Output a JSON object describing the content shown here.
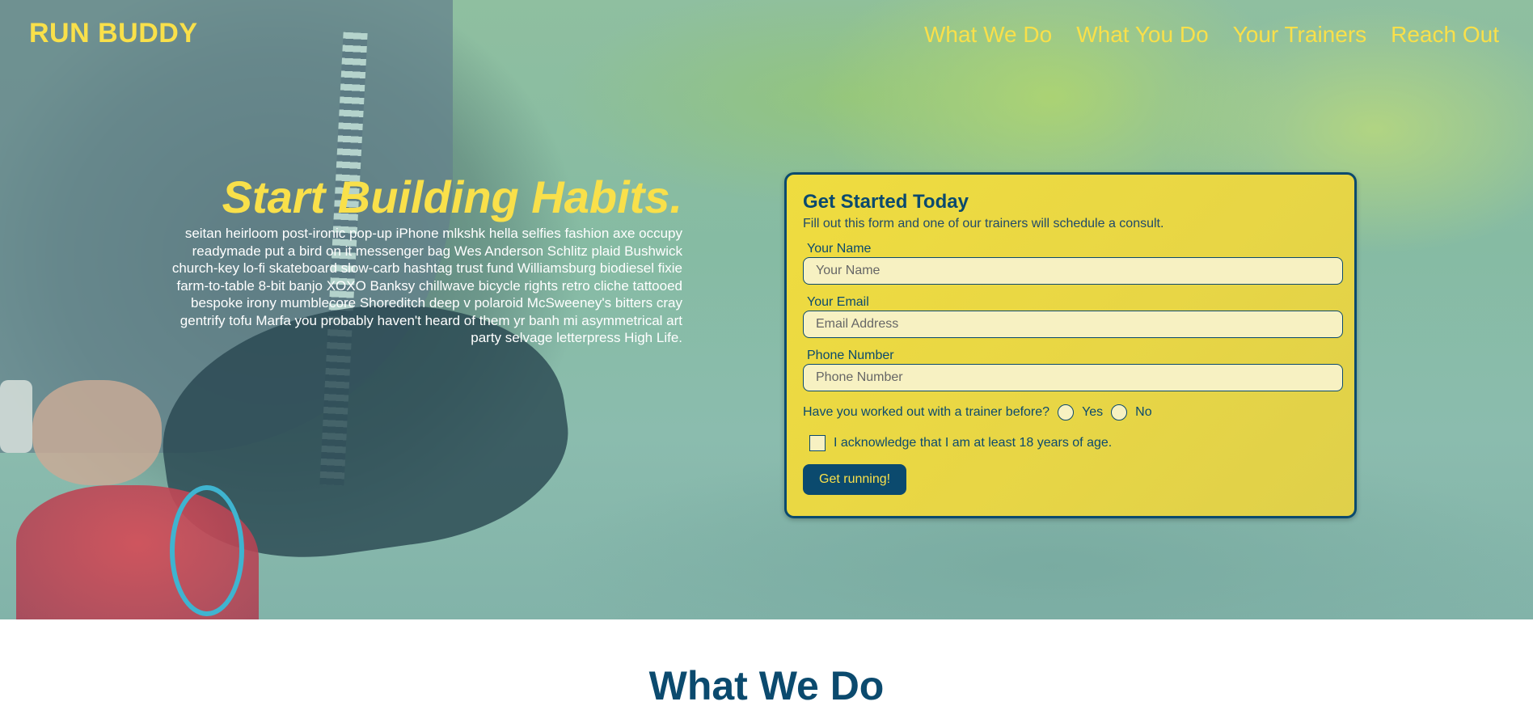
{
  "header": {
    "logo": "RUN BUDDY",
    "nav": [
      "What We Do",
      "What You Do",
      "Your Trainers",
      "Reach Out"
    ]
  },
  "hero": {
    "title": "Start Building Habits.",
    "body": "seitan heirloom post-ironic pop-up iPhone mlkshk hella selfies fashion axe occupy readymade put a bird on it messenger bag Wes Anderson Schlitz plaid Bushwick church-key lo-fi skateboard slow-carb hashtag trust fund Williamsburg biodiesel fixie farm-to-table 8-bit banjo XOXO Banksy chillwave bicycle rights retro cliche tattooed bespoke irony mumblecore Shoreditch deep v polaroid McSweeney's bitters cray gentrify tofu Marfa you probably haven't heard of them yr banh mi asymmetrical art party selvage letterpress High Life."
  },
  "form": {
    "title": "Get Started Today",
    "subtitle": "Fill out this form and one of our trainers will schedule a consult.",
    "name": {
      "label": "Your Name",
      "placeholder": "Your Name"
    },
    "email": {
      "label": "Your Email",
      "placeholder": "Email Address"
    },
    "phone": {
      "label": "Phone Number",
      "placeholder": "Phone Number"
    },
    "trainer_question": "Have you worked out with a trainer before?",
    "option_yes": "Yes",
    "option_no": "No",
    "acknowledge": "I acknowledge that I am at least 18 years of age.",
    "submit": "Get running!"
  },
  "section": {
    "title": "What We Do"
  },
  "colors": {
    "accent_yellow": "#f9e04a",
    "navy": "#0b4a6e",
    "input_bg": "#f7f1c2"
  }
}
